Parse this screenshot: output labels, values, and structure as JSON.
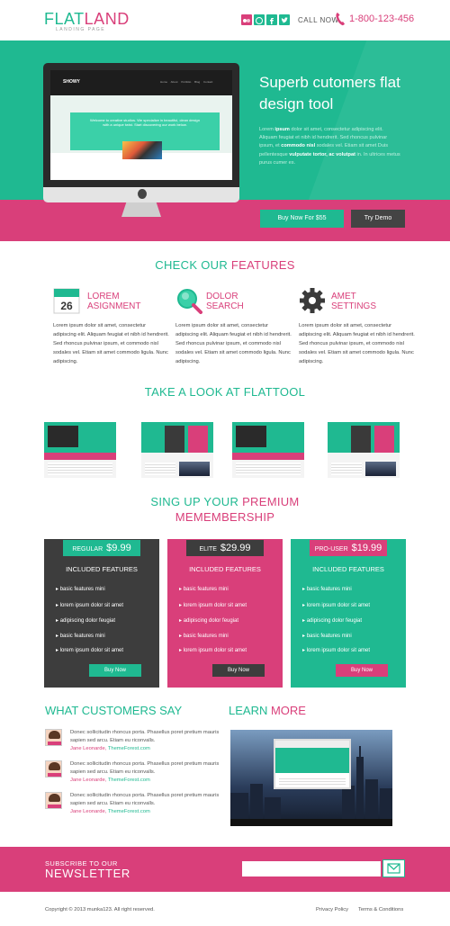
{
  "header": {
    "logo_flat": "FLAT",
    "logo_land": "LAND",
    "logo_sub": "LANDING PAGE",
    "call_label": "CALL NOW",
    "phone": "1-800-123-456",
    "social_icons": [
      "flickr-icon",
      "dribbble-icon",
      "facebook-icon",
      "twitter-icon"
    ]
  },
  "hero": {
    "screen_brand": "SHOWY",
    "screen_menu": "Home About Portfolio Blog Contact",
    "screen_banner": "Welcome to creative studios. We specialize in beautiful, clean design with a unique twist. Start discovering our work below.",
    "title": "Superb cutomers flat design tool",
    "text_1": "Lorem ",
    "text_2": "ipsum",
    "text_3": " dolor sit amet, consectetur adipiscing elit. Aliquam feugiat et nibh id hendrerit. Sed rhoncus pulvinar ipsum, et ",
    "text_4": "commodo nisl",
    "text_5": " sodales vel. Etiam sit amet Duis pellentesque ",
    "text_6": "vulputate tortor, ac volutpat",
    "text_7": " in. In ultrices metus purus cumer es.",
    "buy_label": "Buy Now For $55",
    "demo_label": "Try Demo"
  },
  "features": {
    "title_a": "CHECK OUR ",
    "title_b": "FEATURES",
    "calendar_day": "26",
    "items": [
      {
        "title_1": "LOREM",
        "title_2": "ASIGNMENT",
        "text": "Lorem ipsum dolor sit amet, consectetur adipiscing elit. Aliquam feugiat et nibh id hendrerit. Sed rhoncus pulvinar ipsum, et commodo nisl sodales vel. Etiam sit amet commodo ligula. Nunc adipiscing."
      },
      {
        "title_1": "DOLOR",
        "title_2": "SEARCH",
        "text": "Lorem ipsum dolor sit amet, consectetur adipiscing elit. Aliquam feugiat et nibh id hendrerit. Sed rhoncus pulvinar ipsum, et commodo nisl sodales vel. Etiam sit amet commodo ligula. Nunc adipiscing."
      },
      {
        "title_1": "AMET",
        "title_2": "SETTINGS",
        "text": "Lorem ipsum dolor sit amet, consectetur adipiscing elit. Aliquam feugiat et nibh id hendrerit. Sed rhoncus pulvinar ipsum, et commodo nisl sodales vel. Etiam sit amet commodo ligula. Nunc adipiscing."
      }
    ]
  },
  "gallery": {
    "title_a": "TAKE A LOOK AT ",
    "title_b": "FLATTOOL"
  },
  "pricing": {
    "title_a": "SING UP YOUR ",
    "title_b": "PREMIUM",
    "title_c": "MEMEMBERSHIP",
    "included": "INCLUDED FEATURES",
    "plans": [
      {
        "name": "REGULAR",
        "price": "$9.99",
        "button": "Buy Now"
      },
      {
        "name": "ELITE",
        "price": "$29.99",
        "button": "Buy Now"
      },
      {
        "name": "PRO-USER",
        "price": "$19.99",
        "button": "Buy Now"
      }
    ],
    "features": [
      "basic features mini",
      "lorem ipsum dolor sit amet",
      "adipiscing dolor feugiat",
      "basic features mini",
      "lorem ipsum dolor sit amet"
    ]
  },
  "testimonials": {
    "title_a": "WHAT ",
    "title_b": "CUSTOMERS SAY",
    "items": [
      {
        "quote": "Donec sollicitudin rhoncus porta. Phasellus poret pretium mauris sapien sed arcu. Etiam eu riconvalls.",
        "author": "Jane Leonarde,",
        "site": "ThemeForest.com"
      },
      {
        "quote": "Donec sollicitudin rhoncus porta. Phasellus poret pretium mauris sapien sed arcu. Etiam eu riconvalls.",
        "author": "Jane Leonarde,",
        "site": "ThemeForest.com"
      },
      {
        "quote": "Donec sollicitudin rhoncus porta. Phasellus poret pretium mauris sapien sed arcu. Etiam eu riconvalls.",
        "author": "Jane Leonarde,",
        "site": "ThemeForest.com"
      }
    ]
  },
  "learn": {
    "title_a": "LEARN ",
    "title_b": "MORE"
  },
  "newsletter": {
    "subtitle": "SUBSCRIBE TO OUR",
    "title": "NEWSLETTER",
    "placeholder": "",
    "button_icon": "envelope-icon"
  },
  "footer": {
    "copyright": "Copyright © 2013 munka123. All right reserved.",
    "privacy": "Privacy Policy",
    "terms": "Terms & Conditions"
  },
  "colors": {
    "teal": "#1fb991",
    "pink": "#d93f7a",
    "dark": "#444444"
  }
}
